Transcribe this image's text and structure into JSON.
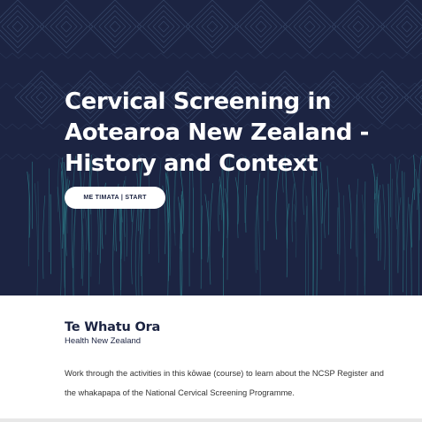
{
  "hero": {
    "title": "Cervical Screening in Aotearoa New Zealand - History and Context",
    "start_button_label": "ME TIMATA | START"
  },
  "brand": {
    "name": "Te Whatu Ora",
    "subtitle": "Health New Zealand"
  },
  "course": {
    "description": "Work through the activities in this kōwae (course) to learn about the NCSP Register and the whakapapa of the National Cervical Screening Programme."
  },
  "colors": {
    "hero_background": "#1c2442",
    "pattern_accent": "#2f8f96",
    "pattern_light": "#3a4d6e",
    "text_dark": "#1c2442",
    "button_background": "#ffffff"
  },
  "icons": {
    "hero_pattern": "woven-taniko-pattern-icon"
  }
}
